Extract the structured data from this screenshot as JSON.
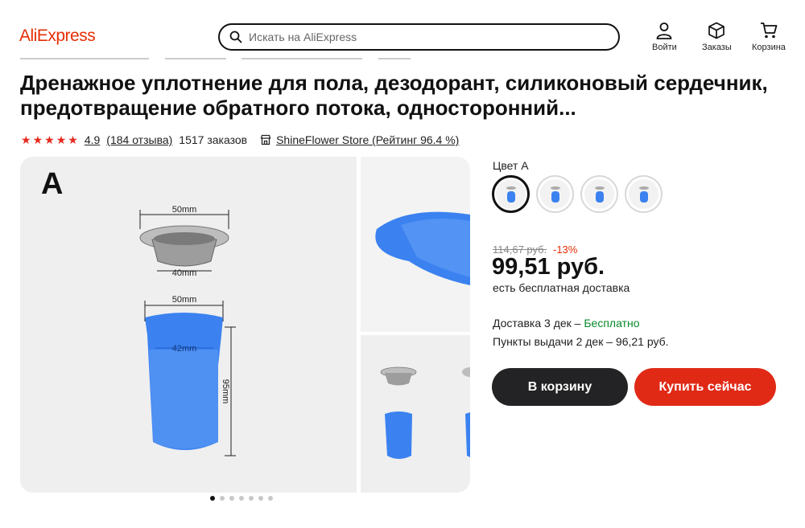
{
  "header": {
    "logo": "AliExpress",
    "search_placeholder": "Искать на AliExpress",
    "nav": [
      {
        "label": "Войти",
        "icon": "user-icon"
      },
      {
        "label": "Заказы",
        "icon": "box-icon"
      },
      {
        "label": "Корзина",
        "icon": "cart-icon"
      }
    ]
  },
  "product": {
    "title": "Дренажное уплотнение для пола, дезодорант, силиконовый сердечник, предотвращение обратного потока, односторонний...",
    "rating": "4.9",
    "reviews": "(184 отзыва)",
    "orders": "1517 заказов",
    "store": "ShineFlower Store (Рейтинг 96.4 %)",
    "stars": 5
  },
  "gallery": {
    "main_letter": "A",
    "dim_top_ring": "50mm",
    "dim_bottom_ring": "40mm",
    "dim_body_top": "50mm",
    "dim_body_inner": "42mm",
    "dim_height": "95mm",
    "slides": 7,
    "active_slide": 0
  },
  "options": {
    "color_label": "Цвет A",
    "swatch_count": 4,
    "selected": 0
  },
  "pricing": {
    "old_price": "114,67 руб.",
    "discount": "-13%",
    "price": "99,51 руб.",
    "free_shipping": "есть бесплатная доставка",
    "delivery_prefix": "Доставка 3 дек – ",
    "delivery_free": "Бесплатно",
    "pickup": "Пункты выдачи 2 дек – 96,21 руб."
  },
  "actions": {
    "add_to_cart": "В корзину",
    "buy_now": "Купить сейчас"
  },
  "colors": {
    "brand": "#e62e04",
    "buy_button": "#e02a16",
    "cart_button": "#232325",
    "star": "#e6281e",
    "free_green": "#0a8a2a",
    "product_blue": "#3b82f0"
  }
}
